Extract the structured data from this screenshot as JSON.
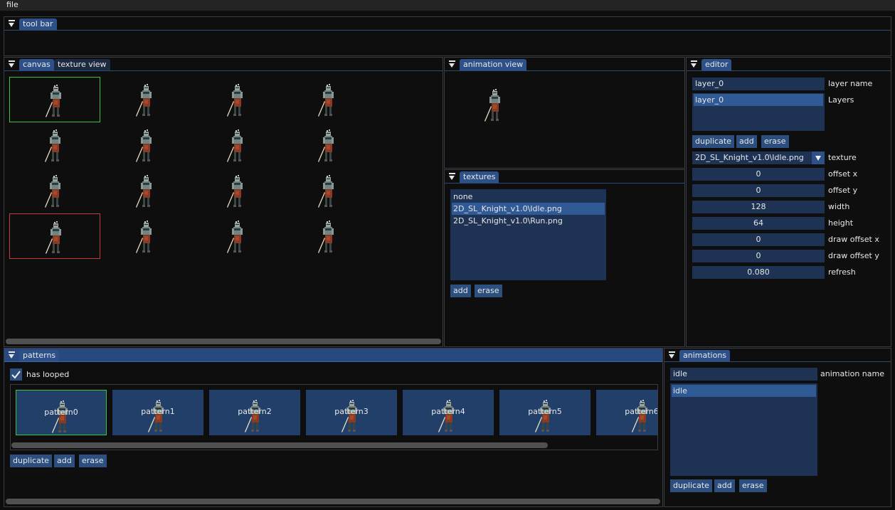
{
  "menu": {
    "file": "file"
  },
  "toolbar_panel": {
    "tab": "tool bar"
  },
  "canvas_panel": {
    "tabs": [
      "canvas",
      "texture view"
    ]
  },
  "animation_view_panel": {
    "tab": "animation view"
  },
  "textures_panel": {
    "tab": "textures",
    "items": [
      "none",
      "2D_SL_Knight_v1.0\\Idle.png",
      "2D_SL_Knight_v1.0\\Run.png"
    ],
    "selected_index": 1,
    "add_label": "add",
    "erase_label": "erase"
  },
  "editor_panel": {
    "tab": "editor",
    "layer_name_value": "layer_0",
    "layer_name_label": "layer name",
    "layers_label": "Layers",
    "layers": [
      "layer_0"
    ],
    "duplicate_label": "duplicate",
    "add_label": "add",
    "erase_label": "erase",
    "texture_value": "2D_SL_Knight_v1.0\\Idle.png",
    "texture_label": "texture",
    "fields": [
      {
        "label": "offset x",
        "value": "0"
      },
      {
        "label": "offset y",
        "value": "0"
      },
      {
        "label": "width",
        "value": "128"
      },
      {
        "label": "height",
        "value": "64"
      },
      {
        "label": "draw offset x",
        "value": "0"
      },
      {
        "label": "draw offset y",
        "value": "0"
      },
      {
        "label": "refresh",
        "value": "0.080"
      }
    ]
  },
  "patterns_panel": {
    "tab": "patterns",
    "has_looped_label": "has looped",
    "has_looped": true,
    "patterns": [
      "pattern0",
      "pattern1",
      "pattern2",
      "pattern3",
      "pattern4",
      "pattern5",
      "pattern6"
    ],
    "duplicate_label": "duplicate",
    "add_label": "add",
    "erase_label": "erase"
  },
  "animations_panel": {
    "tab": "animations",
    "name_value": "idle",
    "name_label": "animation name",
    "items": [
      "idle"
    ],
    "duplicate_label": "duplicate",
    "add_label": "add",
    "erase_label": "erase"
  },
  "colors": {
    "accent": "#2c5087",
    "field_bg": "#1e3354",
    "selected": "#2f5a96",
    "current_frame": "#3fc13f",
    "marked_frame": "#c53a3a"
  }
}
